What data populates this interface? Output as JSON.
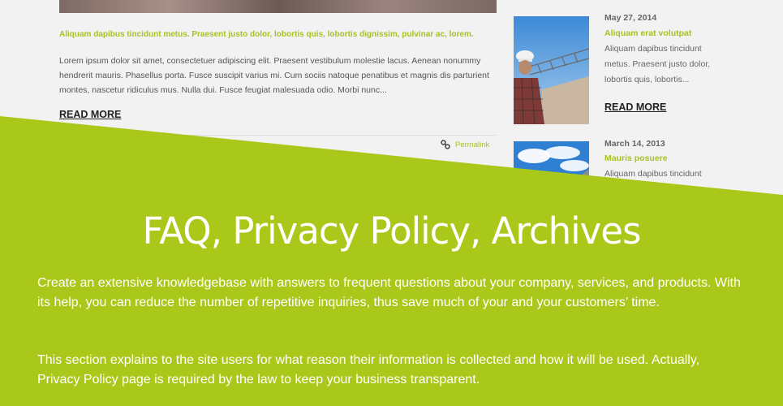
{
  "post": {
    "subtitle": "Aliquam dapibus tincidunt metus. Praesent justo dolor, lobortis quis, lobortis dignissim, pulvinar ac, lorem.",
    "excerpt": "Lorem ipsum dolor sit amet, consectetuer adipiscing elit. Praesent vestibulum molestie lacus. Aenean nonummy hendrerit mauris. Phasellus porta. Fusce suscipit varius mi. Cum sociis natoque penatibus et magnis dis parturient montes, nascetur ridiculus mus. Nulla dui. Fusce feugiat malesuada odio. Morbi nunc...",
    "read_more": "READ MORE",
    "permalink": "Permalink"
  },
  "sidebar": {
    "items": [
      {
        "date": "May 27, 2014",
        "title": "Aliquam erat volutpat",
        "text": "Aliquam dapibus tincidunt metus. Praesent justo dolor, lobortis quis, lobortis...",
        "read_more": "READ MORE"
      },
      {
        "date": "March 14, 2013",
        "title": "Mauris posuere",
        "text": "Aliquam dapibus tincidunt"
      }
    ]
  },
  "banner": {
    "title": "FAQ, Privacy Policy, Archives",
    "paragraph1": "Create an extensive knowledgebase with answers to frequent questions about your company, services, and products. With its help, you can reduce the number of repetitive inquiries, thus save much of your and your customers’ time.",
    "paragraph2": "This section explains to the site users for what reason their information is collected and how it will be used. Actually, Privacy Policy page is required by the law to keep your business transparent."
  },
  "colors": {
    "accent": "#a5c323",
    "banner": "#aac81a",
    "background": "#f2f2f2"
  }
}
